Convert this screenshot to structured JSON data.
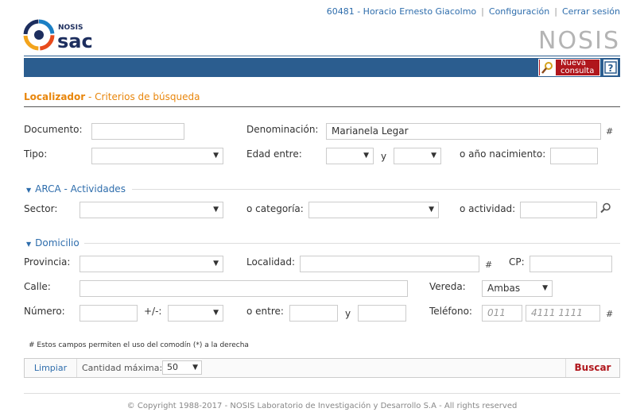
{
  "topnav": {
    "user": "60481 - Horacio Ernesto Giacolmo",
    "config": "Configuración",
    "logout": "Cerrar sesión"
  },
  "logo": {
    "line1": "NOSIS",
    "line2": "SAC"
  },
  "brand": "NOSIS",
  "toolbar": {
    "new_query": [
      "Nueva",
      "consulta"
    ],
    "help": "?"
  },
  "page": {
    "title": "Localizador",
    "subtitle": "- Criterios de búsqueda"
  },
  "form": {
    "documento": {
      "label": "Documento:",
      "value": ""
    },
    "denominacion": {
      "label": "Denominación:",
      "value": "Marianela Legar",
      "hint": "#"
    },
    "tipo": {
      "label": "Tipo:",
      "value": ""
    },
    "edad": {
      "label": "Edad entre:",
      "and": "y",
      "from": "",
      "to": ""
    },
    "anio": {
      "label": "o año nacimiento:",
      "value": ""
    }
  },
  "arca": {
    "title": "ARCA - Actividades",
    "sector": {
      "label": "Sector:",
      "value": ""
    },
    "categoria": {
      "label": "o categoría:",
      "value": ""
    },
    "actividad": {
      "label": "o actividad:",
      "value": ""
    }
  },
  "domicilio": {
    "title": "Domicilio",
    "provincia": {
      "label": "Provincia:",
      "value": ""
    },
    "localidad": {
      "label": "Localidad:",
      "value": "",
      "hint": "#"
    },
    "cp": {
      "label": "CP:",
      "value": ""
    },
    "calle": {
      "label": "Calle:",
      "value": ""
    },
    "vereda": {
      "label": "Vereda:",
      "value": "Ambas"
    },
    "numero": {
      "label": "Número:",
      "value": ""
    },
    "masmenos": {
      "label": "+/-:",
      "value": ""
    },
    "entre": {
      "label": "o entre:",
      "and": "y"
    },
    "telefono": {
      "label": "Teléfono:",
      "area_placeholder": "011",
      "number_placeholder": "4111 1111",
      "hint": "#"
    }
  },
  "note": "# Estos campos permiten el uso del comodín (*) a la derecha",
  "footer": {
    "clear": "Limpiar",
    "max_label": "Cantidad máxima:",
    "max_value": "50",
    "search": "Buscar"
  },
  "copyright": "© Copyright 1988-2017 - NOSIS Laboratorio de Investigación y Desarrollo S.A - All rights reserved",
  "colors": {
    "accent": "#e8860c",
    "link": "#2e6dac",
    "bar": "#2b5d8f",
    "action": "#b0161c"
  }
}
